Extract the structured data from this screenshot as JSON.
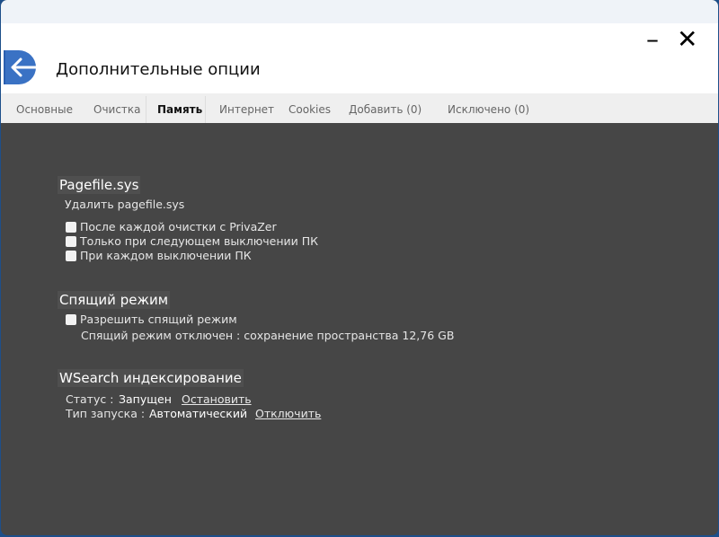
{
  "window": {
    "title": "Дополнительные опции",
    "minimize": "–",
    "close": "✕"
  },
  "tabs": [
    {
      "label": "Основные"
    },
    {
      "label": "Очистка"
    },
    {
      "label": "Память",
      "active": true
    },
    {
      "label": "Интернет"
    },
    {
      "label": "Cookies"
    },
    {
      "label": "Добавить (0)"
    },
    {
      "label": "Исключено (0)"
    }
  ],
  "pagefile": {
    "heading": "Pagefile.sys",
    "subheading": "Удалить pagefile.sys",
    "options": [
      {
        "label": "После каждой очистки с PrivaZer",
        "checked": false
      },
      {
        "label": "Только при следующем выключении ПК",
        "checked": false
      },
      {
        "label": "При каждом выключении ПК",
        "checked": false
      }
    ]
  },
  "hibernate": {
    "heading": "Спящий режим",
    "option": {
      "label": "Разрешить спящий режим",
      "checked": false
    },
    "info": "Спящий режим отключен : сохранение пространства 12,76 GB"
  },
  "wsearch": {
    "heading": "WSearch индексирование",
    "status_label": "Статус :",
    "status_value": "Запущен",
    "status_action": "Остановить",
    "start_label": "Тип запуска :",
    "start_value": "Автоматический",
    "start_action": "Отключить"
  }
}
